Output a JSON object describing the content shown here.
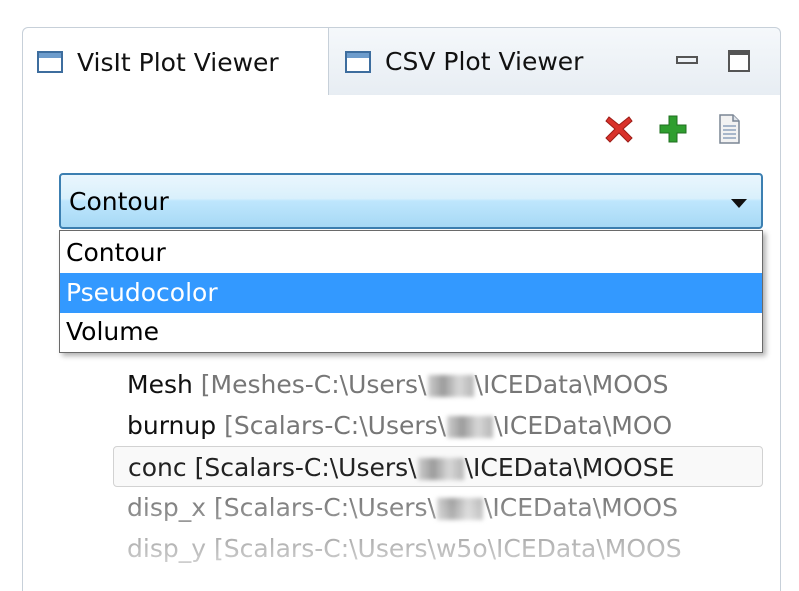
{
  "tabs": [
    {
      "label": "VisIt Plot Viewer",
      "active": true
    },
    {
      "label": "CSV Plot Viewer",
      "active": false
    }
  ],
  "window_controls": [
    "minimize-icon",
    "maximize-icon"
  ],
  "toolbar": {
    "icons": [
      "delete-icon",
      "add-icon",
      "document-icon"
    ],
    "colors": {
      "delete": "#d9322b",
      "add": "#2f9e2f"
    }
  },
  "plot_type_combo": {
    "selected": "Contour",
    "options": [
      "Contour",
      "Pseudocolor",
      "Volume"
    ],
    "highlighted": "Pseudocolor"
  },
  "tree": [
    {
      "name": "Mesh",
      "detail_pre": " [Meshes-C:\\Users\\",
      "detail_post": "\\ICEData\\MOOS"
    },
    {
      "name": "burnup",
      "detail_pre": " [Scalars-C:\\Users\\",
      "detail_post": "\\ICEData\\MOO"
    },
    {
      "name": "conc",
      "detail_pre": " [Scalars-C:\\Users\\",
      "detail_post": "\\ICEData\\MOOSE"
    },
    {
      "name": "disp_x",
      "detail_pre": " [Scalars-C:\\Users\\",
      "detail_post": "\\ICEData\\MOOS"
    },
    {
      "name": "disp_y",
      "detail_pre": " [Scalars-C:\\Users\\w5o\\ICEData\\MOOS",
      "detail_post": ""
    }
  ],
  "colors": {
    "selection": "#3399ff",
    "combo_border": "#3c7fb1",
    "tab_icon": "#3d6d9e"
  }
}
